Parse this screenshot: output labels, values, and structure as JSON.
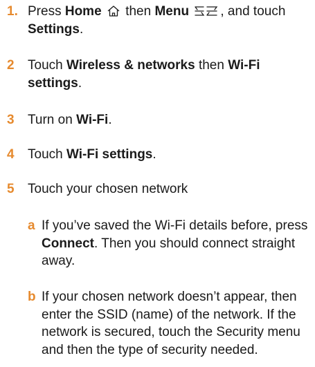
{
  "steps": [
    {
      "num": "1.",
      "press": "Press ",
      "home": "Home",
      "then": " then ",
      "menu": "Menu",
      "and_touch": ", and touch",
      "settings": "Settings",
      "period": "."
    },
    {
      "num": "2",
      "touch": "Touch ",
      "wireless": "Wireless & networks",
      "then": " then ",
      "wifi_settings": "Wi-Fi settings",
      "period": "."
    },
    {
      "num": "3",
      "turn_on": "Turn on ",
      "wifi": "Wi-Fi",
      "period": "."
    },
    {
      "num": "4",
      "touch": "Touch ",
      "wifi_settings": "Wi-Fi settings",
      "period": "."
    },
    {
      "num": "5",
      "text": "Touch your chosen network"
    }
  ],
  "substeps": [
    {
      "letter": "a",
      "pre": "If you’ve saved the Wi-Fi details before, press ",
      "connect": "Connect",
      "post": ". Then you should connect straight away."
    },
    {
      "letter": "b",
      "text": "If your chosen network doesn’t appear, then enter the SSID (name) of the network. If the network is secured, touch the Security menu and then the type of security needed."
    }
  ],
  "icons": {
    "home": "home-icon",
    "menu": "menu-icon"
  },
  "colors": {
    "step_number": "#e68a2e",
    "text": "#1a1a1a"
  }
}
